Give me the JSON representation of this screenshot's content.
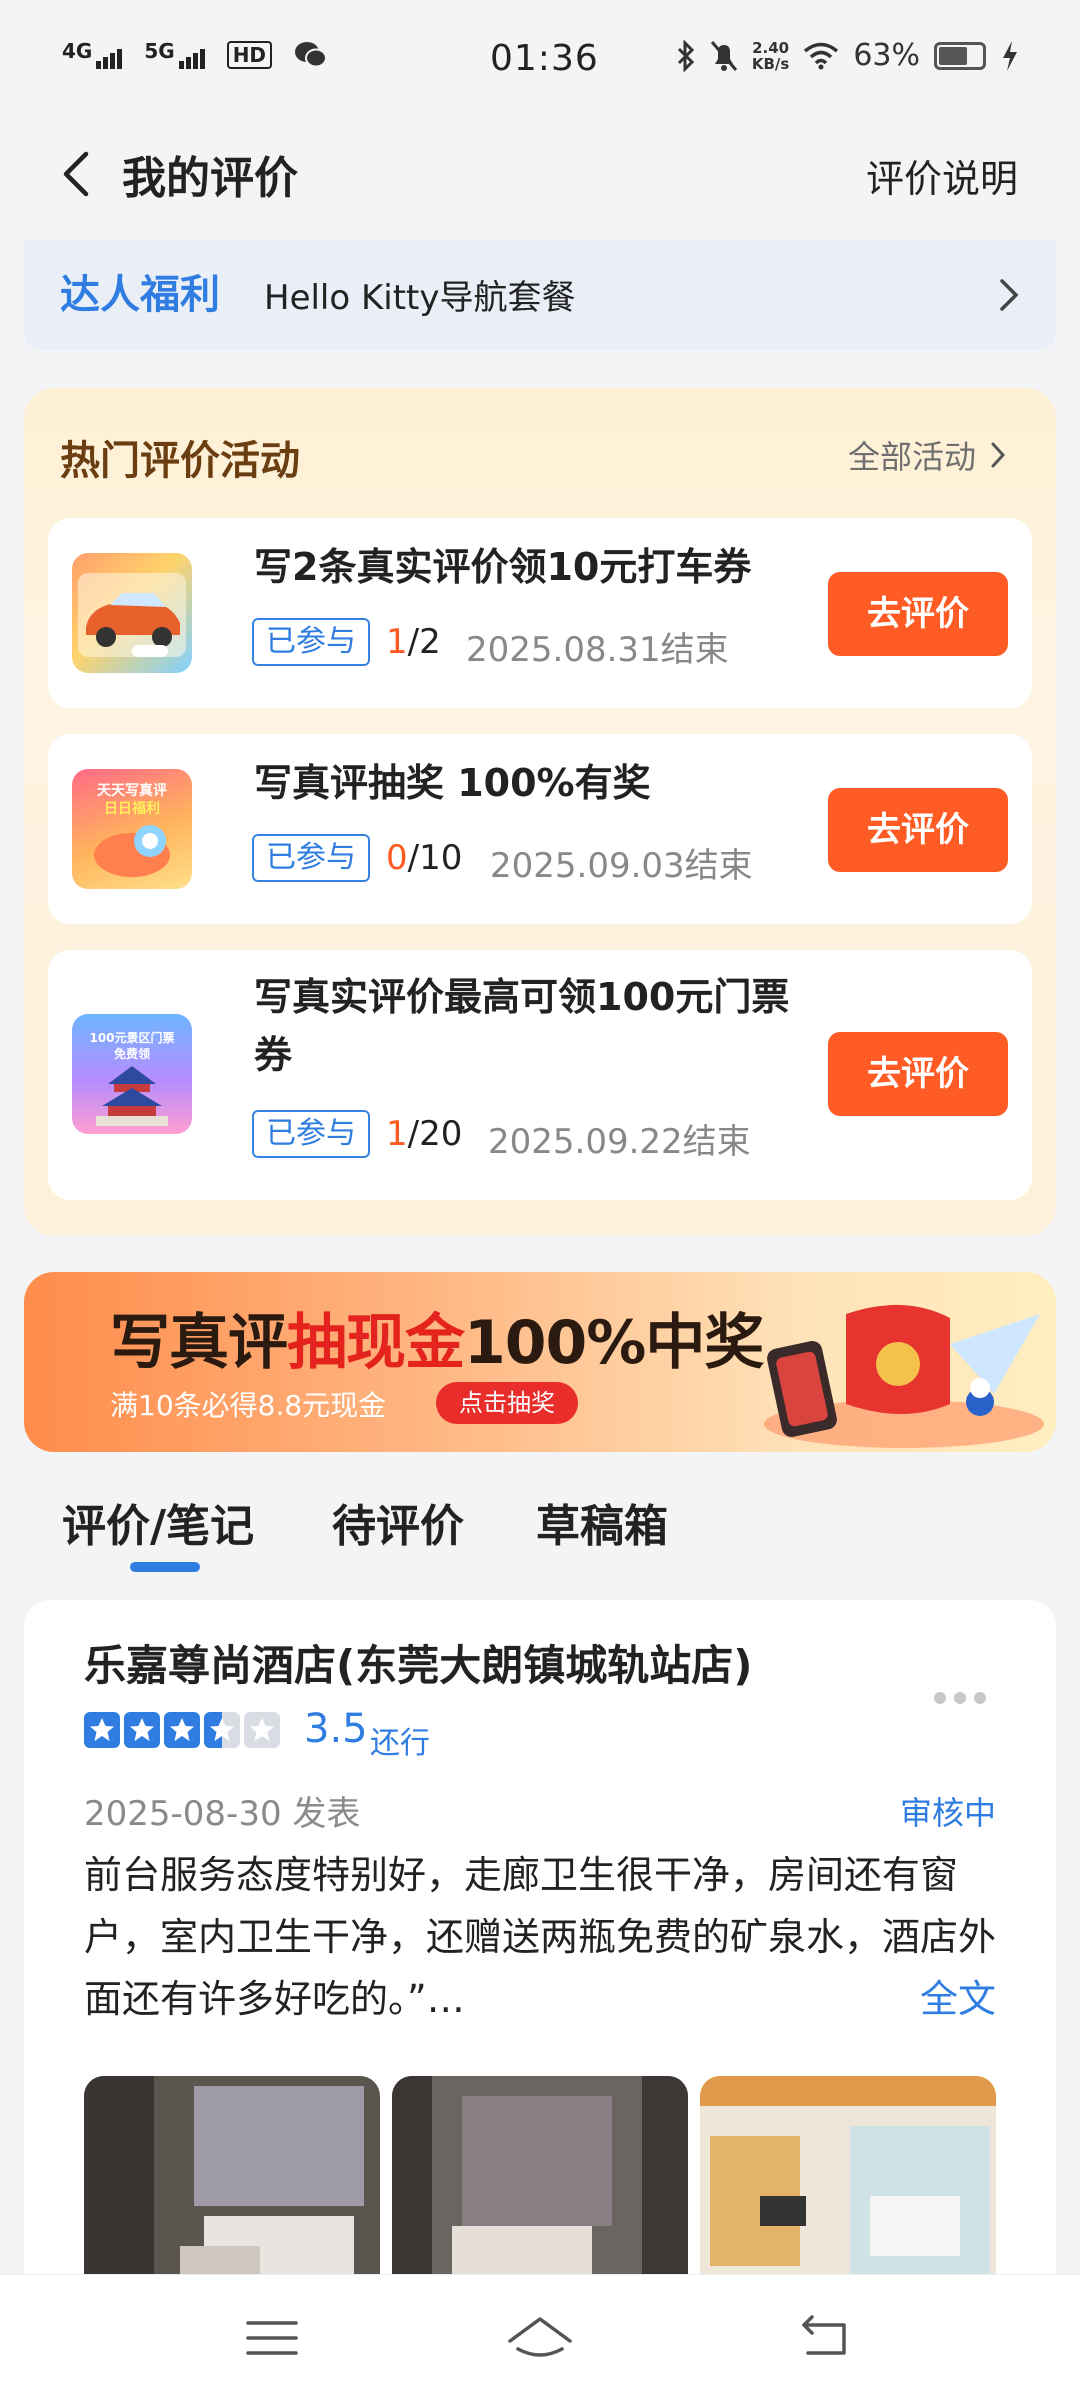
{
  "status_bar": {
    "network1": "4G",
    "network2": "5G",
    "hd": "HD",
    "time": "01:36",
    "speed_value": "2.40",
    "speed_unit": "KB/s",
    "battery": "63%",
    "battery_level": 0.63
  },
  "header": {
    "title": "我的评价",
    "help_link": "评价说明"
  },
  "perk": {
    "tag": "达人福利",
    "text": "Hello Kitty导航套餐"
  },
  "activities": {
    "title": "热门评价活动",
    "all_link": "全部活动",
    "items": [
      {
        "name": "写2条真实评价领10元打车券",
        "badge": "已参与",
        "current": "1",
        "total": "/2",
        "deadline": "2025.08.31结束",
        "button": "去评价"
      },
      {
        "name": "写真评抽奖 100%有奖",
        "badge": "已参与",
        "current": "0",
        "total": "/10",
        "deadline": "2025.09.03结束",
        "button": "去评价"
      },
      {
        "name": "写真实评价最高可领100元门票券",
        "badge": "已参与",
        "current": "1",
        "total": "/20",
        "deadline": "2025.09.22结束",
        "button": "去评价"
      }
    ],
    "thumb_texts": [
      "天天写真评",
      "日日福利",
      "100元景区门票",
      "免费领"
    ]
  },
  "promo": {
    "title_a": "写真评",
    "title_b": "抽现金",
    "title_c": "100%中奖",
    "subtitle": "满10条必得8.8元现金",
    "button": "点击抽奖"
  },
  "tabs": [
    "评价/笔记",
    "待评价",
    "草稿箱"
  ],
  "review": {
    "hotel": "乐嘉尊尚酒店(东莞大朗镇城轨站店)",
    "rating": 3.5,
    "score": "3.5",
    "score_label": "还行",
    "date": "2025-08-30 发表",
    "status": "审核中",
    "text": "前台服务态度特别好，走廊卫生很干净，房间还有窗户，室内卫生干净，还赠送两瓶免费的矿泉水，酒店外面还有许多好吃的。”…",
    "full_text_link": "全文"
  },
  "colors": {
    "accent": "#2f7de1",
    "cta": "#ff5b25",
    "activity_bg": "#fef0d4"
  }
}
